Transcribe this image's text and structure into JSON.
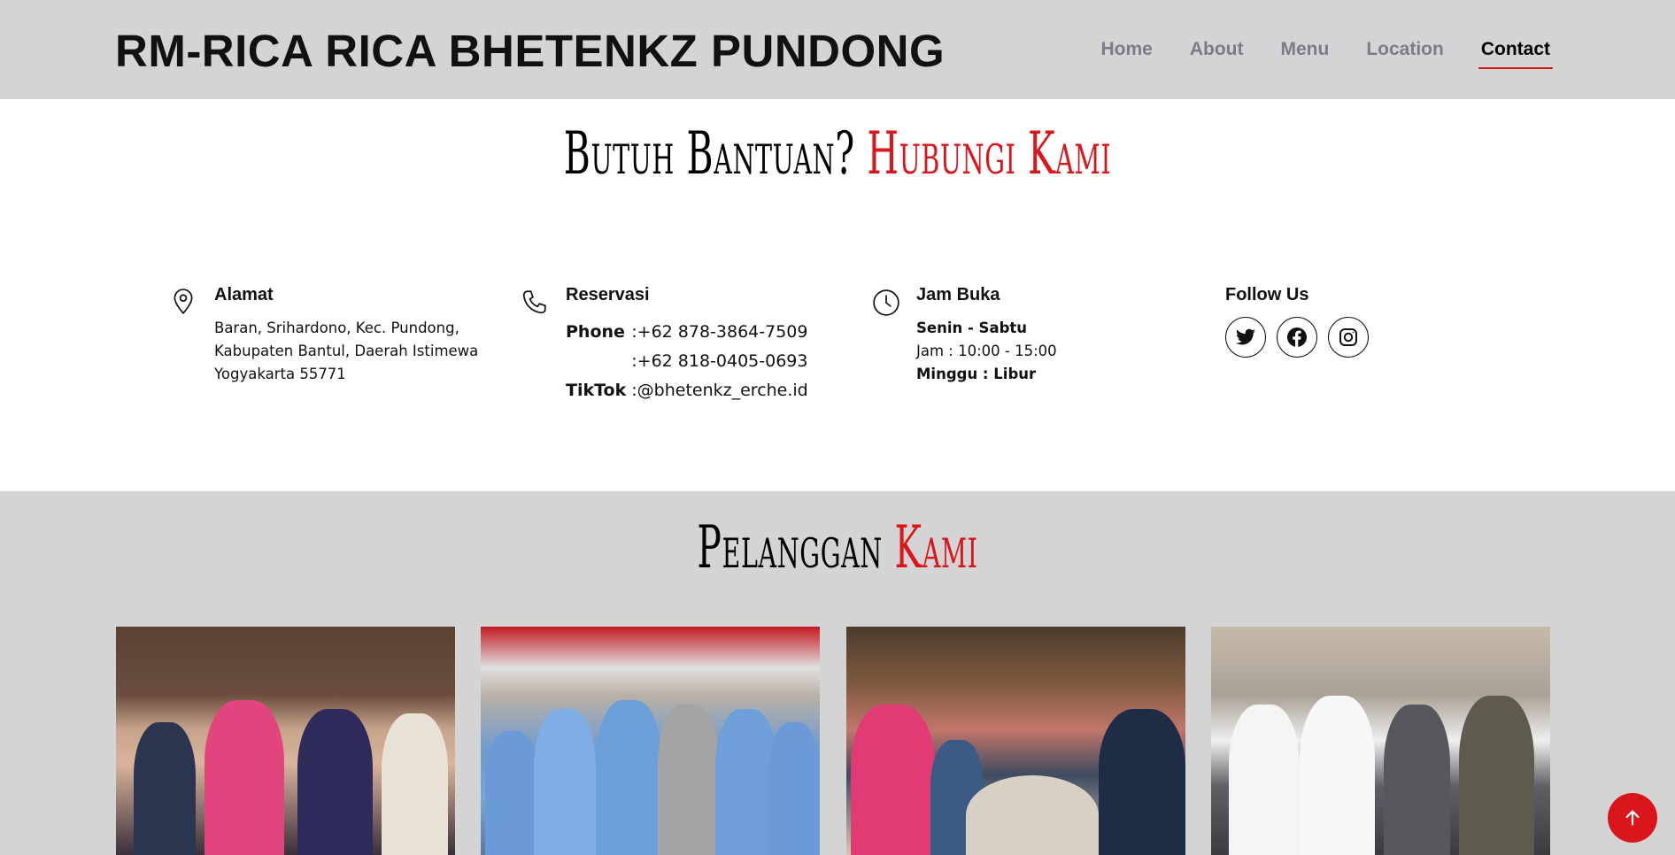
{
  "header": {
    "brand": "RM-RICA RICA BHETENKZ PUNDONG",
    "nav": [
      {
        "label": "Home",
        "active": false
      },
      {
        "label": "About",
        "active": false
      },
      {
        "label": "Menu",
        "active": false
      },
      {
        "label": "Location",
        "active": false
      },
      {
        "label": "Contact",
        "active": true
      }
    ]
  },
  "contact": {
    "title_part1": "Butuh Bantuan?",
    "title_part2": "Hubungi Kami",
    "alamat": {
      "heading": "Alamat",
      "icon": "map-pin-icon",
      "text": "Baran, Srihardono, Kec. Pundong, Kabupaten Bantul, Daerah Istimewa Yogyakarta 55771"
    },
    "reservasi": {
      "heading": "Reservasi",
      "icon": "phone-icon",
      "rows": [
        {
          "label": "Phone",
          "sep": ":",
          "value": "+62 878-3864-7509"
        },
        {
          "label": "",
          "sep": ":",
          "value": "+62 818-0405-0693"
        },
        {
          "label": "TikTok",
          "sep": ":",
          "value": "@bhetenkz_erche.id"
        }
      ]
    },
    "jam": {
      "heading": "Jam Buka",
      "icon": "clock-icon",
      "days": "Senin - Sabtu",
      "hours": "Jam : 10:00 - 15:00",
      "closed": "Minggu : Libur"
    },
    "follow": {
      "heading": "Follow Us",
      "socials": [
        "twitter-icon",
        "facebook-icon",
        "instagram-icon"
      ]
    }
  },
  "customers": {
    "title_part1": "Pelanggan",
    "title_part2": "Kami"
  },
  "colors": {
    "accent": "#d9161c",
    "header_bg": "#d4d4d4",
    "nav_inactive": "#7a7d88"
  }
}
